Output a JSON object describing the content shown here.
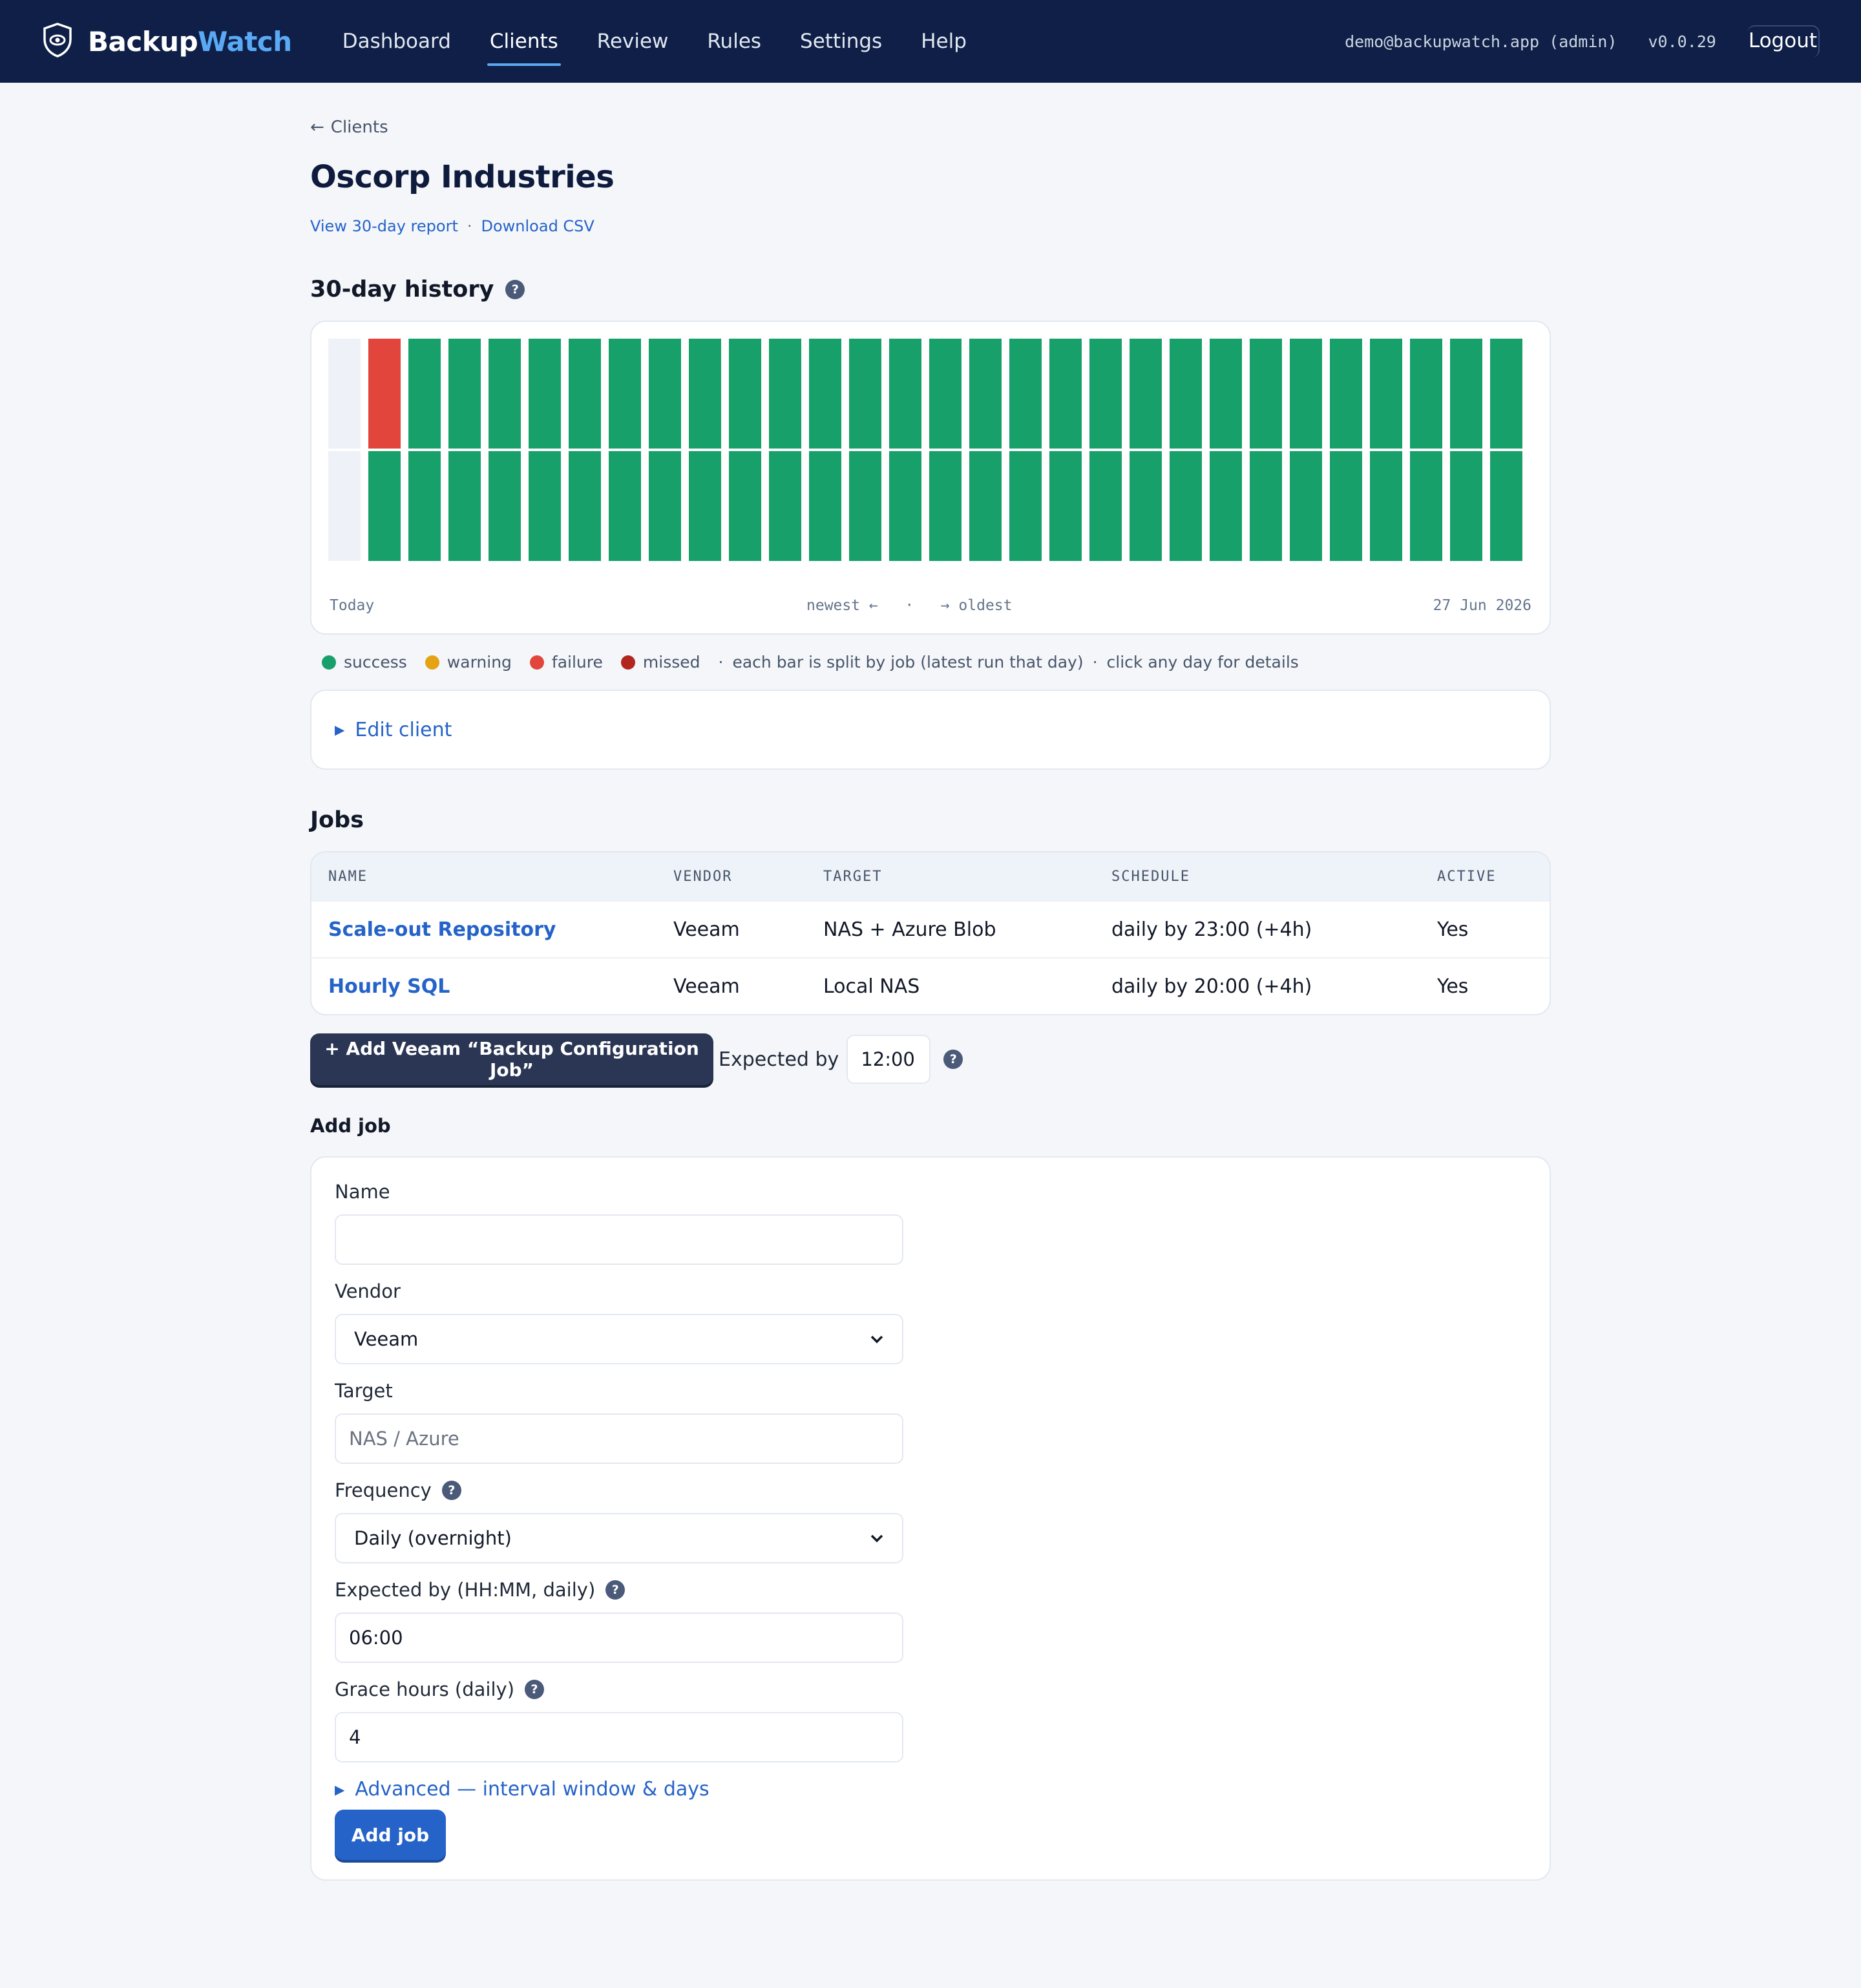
{
  "app": {
    "brand_part1": "Backup",
    "brand_part2": "Watch",
    "nav": [
      {
        "label": "Dashboard",
        "active": false
      },
      {
        "label": "Clients",
        "active": true
      },
      {
        "label": "Review",
        "active": false
      },
      {
        "label": "Rules",
        "active": false
      },
      {
        "label": "Settings",
        "active": false
      },
      {
        "label": "Help",
        "active": false
      }
    ],
    "user": "demo@backupwatch.app (admin)",
    "version": "v0.0.29",
    "logout_label": "Logout"
  },
  "breadcrumb": {
    "arrow": "←",
    "label": "Clients"
  },
  "client": {
    "name": "Oscorp Industries",
    "report_link": "View 30-day report",
    "separator": "·",
    "csv_link": "Download CSV"
  },
  "history": {
    "title": "30-day history",
    "help_icon": "?",
    "label_left": "Today",
    "label_mid": "newest ←   ·   → oldest",
    "label_right": "27 Jun 2026",
    "colors": {
      "success": "#18a06b",
      "warning": "#e5a312",
      "failure": "#e1453b",
      "missed": "#b3261e",
      "empty": "#eef1f7"
    },
    "chart_data": {
      "type": "bar",
      "note": "30 day columns, each split by job (2 jobs). Day 1 = today (no runs yet).",
      "series": [
        {
          "values": [
            "empty",
            "failure",
            "success",
            "success",
            "success",
            "success",
            "success",
            "success",
            "success",
            "success",
            "success",
            "success",
            "success",
            "success",
            "success",
            "success",
            "success",
            "success",
            "success",
            "success",
            "success",
            "success",
            "success",
            "success",
            "success",
            "success",
            "success",
            "success",
            "success",
            "success"
          ]
        },
        {
          "values": [
            "empty",
            "success",
            "success",
            "success",
            "success",
            "success",
            "success",
            "success",
            "success",
            "success",
            "success",
            "success",
            "success",
            "success",
            "success",
            "success",
            "success",
            "success",
            "success",
            "success",
            "success",
            "success",
            "success",
            "success",
            "success",
            "success",
            "success",
            "success",
            "success",
            "success"
          ]
        }
      ]
    },
    "legend": [
      {
        "label": "success",
        "color": "#18a06b"
      },
      {
        "label": "warning",
        "color": "#e5a312"
      },
      {
        "label": "failure",
        "color": "#e1453b"
      },
      {
        "label": "missed",
        "color": "#b3261e"
      }
    ],
    "legend_note1": "each bar is split by job (latest run that day)",
    "legend_note2": "click any day for details",
    "legend_sep": "·"
  },
  "edit_client": {
    "label": "Edit client",
    "marker": "▶"
  },
  "jobs": {
    "title": "Jobs",
    "columns": [
      "NAME",
      "VENDOR",
      "TARGET",
      "SCHEDULE",
      "ACTIVE"
    ],
    "rows": [
      {
        "name": "Scale-out Repository",
        "vendor": "Veeam",
        "target": "NAS + Azure Blob",
        "schedule": "daily by 23:00 (+4h)",
        "active": "Yes"
      },
      {
        "name": "Hourly SQL",
        "vendor": "Veeam",
        "target": "Local NAS",
        "schedule": "daily by 20:00 (+4h)",
        "active": "Yes"
      }
    ]
  },
  "quick_add": {
    "button_label": "+ Add Veeam “Backup Configuration Job”",
    "expected_label": "Expected by",
    "expected_value": "12:00",
    "help_icon": "?"
  },
  "add_job": {
    "title": "Add job",
    "name_label": "Name",
    "name_value": "",
    "vendor_label": "Vendor",
    "vendor_value": "Veeam",
    "target_label": "Target",
    "target_placeholder": "NAS / Azure",
    "frequency_label": "Frequency",
    "frequency_value": "Daily (overnight)",
    "expected_label": "Expected by (HH:MM, daily)",
    "expected_value": "06:00",
    "grace_label": "Grace hours (daily)",
    "grace_value": "4",
    "advanced_label": "Advanced — interval window & days",
    "advanced_marker": "▶",
    "submit_label": "Add job",
    "help_icon": "?",
    "chevron": "⌄"
  }
}
